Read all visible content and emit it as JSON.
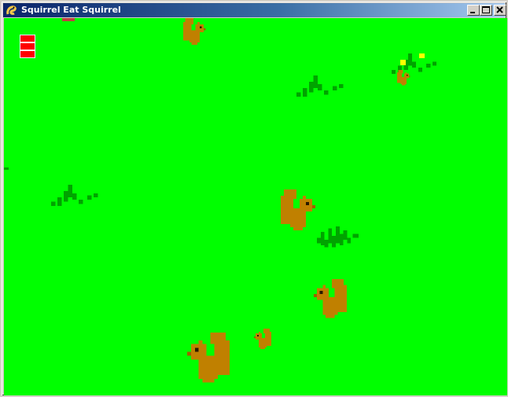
{
  "window": {
    "title": "Squirrel Eat Squirrel",
    "title_bar_colors": [
      "#0a246a",
      "#a6caf0"
    ],
    "buttons": [
      "minimize-icon",
      "maximize-icon",
      "close-icon"
    ]
  },
  "game": {
    "background_color": "#00ff00",
    "grass_color": "#00a300",
    "squirrel_color": "#c08000",
    "health": {
      "max": 3,
      "current": 3,
      "color": "#ff0000"
    }
  }
}
